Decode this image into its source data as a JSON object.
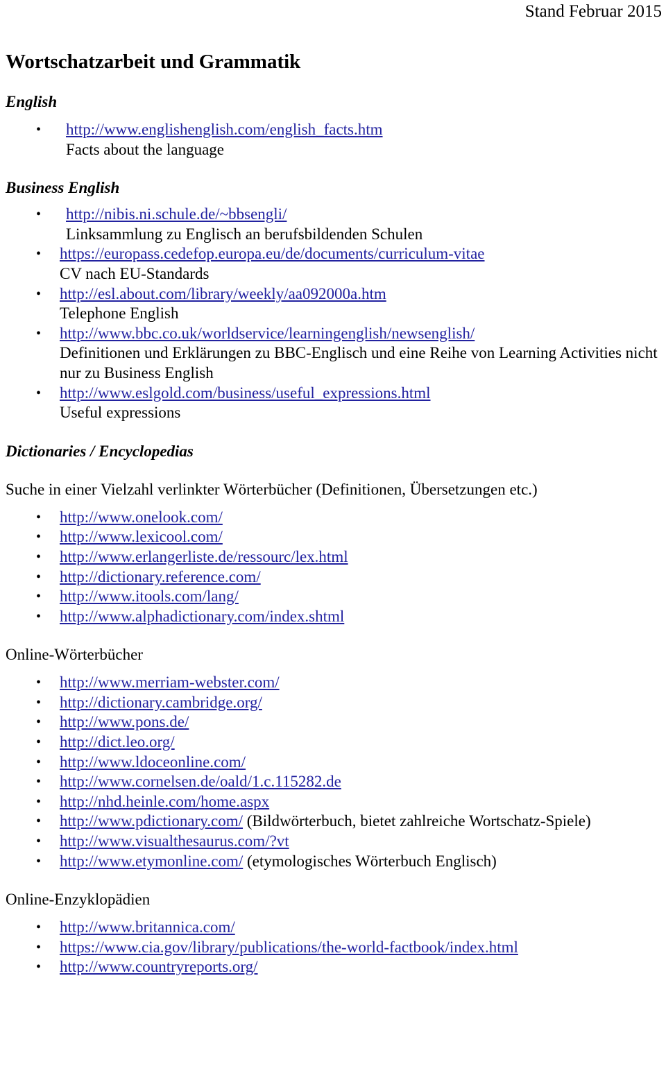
{
  "header": {
    "stand": "Stand Februar 2015"
  },
  "document": {
    "title": "Wortschatzarbeit und Grammatik"
  },
  "sections": [
    {
      "heading": "English",
      "items": [
        {
          "url": "http://www.englishenglish.com/english_facts.htm",
          "desc": "Facts about the language"
        }
      ]
    },
    {
      "heading": "Business English",
      "items": [
        {
          "url": "http://nibis.ni.schule.de/~bbsengli/",
          "desc": "Linksammlung zu Englisch an berufsbildenden Schulen"
        },
        {
          "url": "https://europass.cedefop.europa.eu/de/documents/curriculum-vitae",
          "desc": "CV nach EU-Standards"
        },
        {
          "url": "http://esl.about.com/library/weekly/aa092000a.htm",
          "desc": "Telephone English"
        },
        {
          "url": "http://www.bbc.co.uk/worldservice/learningenglish/newsenglish/",
          "desc": "Definitionen und Erklärungen zu BBC-Englisch und eine Reihe von Learning Activities nicht nur zu Business English"
        },
        {
          "url": "http://www.eslgold.com/business/useful_expressions.html",
          "desc": "Useful expressions"
        }
      ]
    }
  ],
  "dictionaries": {
    "heading": "Dictionaries / Encyclopedias",
    "intro": "Suche in einer Vielzahl verlinkter Wörterbücher (Definitionen, Übersetzungen etc.)",
    "items": [
      {
        "url": "http://www.onelook.com/"
      },
      {
        "url": "http://www.lexicool.com/"
      },
      {
        "url": "http://www.erlangerliste.de/ressourc/lex.html"
      },
      {
        "url": "http://dictionary.reference.com/"
      },
      {
        "url": "http://www.itools.com/lang/"
      },
      {
        "url": "http://www.alphadictionary.com/index.shtml"
      }
    ]
  },
  "online_dictionaries": {
    "heading": "Online-Wörterbücher",
    "items": [
      {
        "url": "http://www.merriam-webster.com/",
        "note": ""
      },
      {
        "url": "http://dictionary.cambridge.org/",
        "note": ""
      },
      {
        "url": "http://www.pons.de/",
        "note": ""
      },
      {
        "url": "http://dict.leo.org/",
        "note": ""
      },
      {
        "url": "http://www.ldoceonline.com/",
        "note": ""
      },
      {
        "url": "http://www.cornelsen.de/oald/1.c.115282.de",
        "note": ""
      },
      {
        "url": "http://nhd.heinle.com/home.aspx",
        "note": ""
      },
      {
        "url": "http://www.pdictionary.com/",
        "note": " (Bildwörterbuch, bietet zahlreiche Wortschatz-Spiele)"
      },
      {
        "url": "http://www.visualthesaurus.com/?vt",
        "note": ""
      },
      {
        "url": "http://www.etymonline.com/",
        "note": " (etymologisches Wörterbuch Englisch)"
      }
    ]
  },
  "encyclopedias": {
    "heading": "Online-Enzyklopädien",
    "items": [
      {
        "url": "http://www.britannica.com/"
      },
      {
        "url": "https://www.cia.gov/library/publications/the-world-factbook/index.html"
      },
      {
        "url": "http://www.countryreports.org/"
      }
    ]
  },
  "colors": {
    "link": "#2222a0",
    "text": "#000000",
    "background": "#ffffff"
  }
}
